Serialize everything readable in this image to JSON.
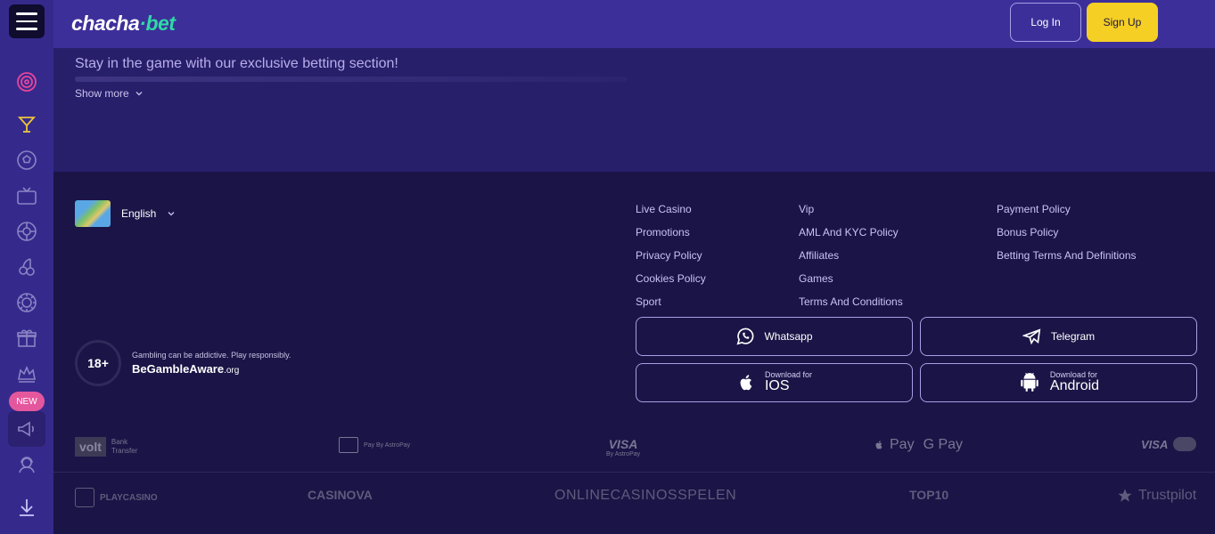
{
  "header": {
    "logo_main": "chacha",
    "logo_dot": "·",
    "logo_suffix": "bet",
    "login_label": "Log In",
    "signup_label": "Sign Up"
  },
  "sidebar": {
    "new_badge": "NEW",
    "icons": [
      "target-icon",
      "cocktail-icon",
      "soccer-ball-icon",
      "live-tv-icon",
      "roulette-icon",
      "cherries-icon",
      "poker-chip-icon",
      "gift-icon",
      "crown-icon",
      "megaphone-icon",
      "support-agent-icon",
      "download-icon"
    ]
  },
  "upper": {
    "tagline": "Stay in the game with our exclusive betting section!",
    "show_more": "Show more"
  },
  "footer": {
    "language": "English",
    "links_col1": [
      "Live Casino",
      "Promotions",
      "Privacy Policy",
      "Cookies Policy",
      "Sport"
    ],
    "links_col2": [
      "Vip",
      "AML And KYC Policy",
      "Affiliates",
      "Games",
      "Terms And Conditions"
    ],
    "links_col3": [
      "Payment Policy",
      "Bonus Policy",
      "Betting Terms And Definitions"
    ],
    "whatsapp_label": "Whatsapp",
    "telegram_label": "Telegram",
    "ios_small": "Download for",
    "ios_big": "IOS",
    "android_small": "Download for",
    "android_big": "Android",
    "age_badge": "18+",
    "gamble_warning": "Gambling can be addictive. Play responsibly.",
    "gamble_aware_main": "BeGambleAware",
    "gamble_aware_suffix": ".org",
    "payments": {
      "volt": "volt",
      "volt_sub1": "Bank",
      "volt_sub2": "Transfer",
      "astropay": "Pay By AstroPay",
      "visa": "VISA",
      "visa_sub": "By AstroPay",
      "applepay": "Pay",
      "gpay": "G Pay",
      "visa2": "VISA"
    },
    "partners": {
      "playcasino": "PLAYCASINO",
      "casinova": "CASINOVA",
      "online_casinos": "ONLINECASINOSSPELEN",
      "top10": "TOP10",
      "trustpilot": "Trustpilot"
    }
  }
}
